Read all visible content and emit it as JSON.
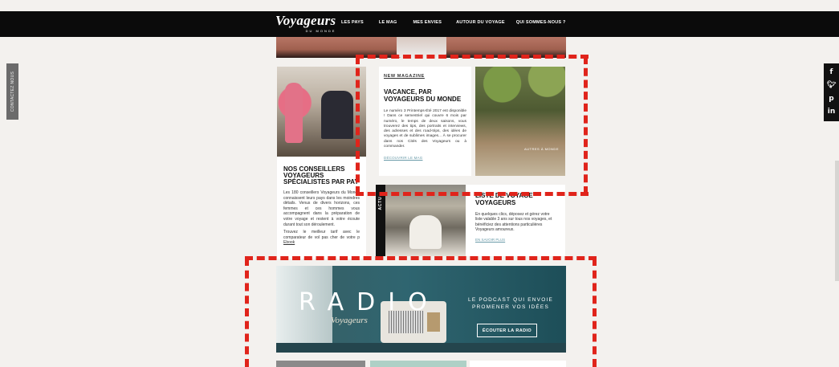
{
  "nav": {
    "logo": "Voyageurs",
    "logo_sub": "DU MONDE",
    "items": [
      "LES PAYS",
      "LE MAG",
      "MES ENVIES",
      "AUTOUR DU VOYAGE",
      "QUI SOMMES-NOUS ?"
    ]
  },
  "contact_tab": "CONTACTEZ NOUS",
  "social": [
    "f",
    "t",
    "p",
    "in"
  ],
  "conseillers": {
    "title": "NOS CONSEILLERS VOYAGEURS SPÉCIALISTES PAR PAY",
    "p1": "Les 180 conseillers Voyageurs du Monde connaissent leurs pays dans les moindres détails. Venus de divers horizons, ces femmes et ces hommes vous accompagnent dans la préparation de votre voyage et restent à votre écoute durant tout son déroulement.",
    "p2": "Trouvez le meilleur tarif avec le comparateur de vol pas cher de votre p",
    "p2_link": "Ebook"
  },
  "magazine": {
    "tag": "NEW MAGAZINE",
    "title": "VACANCE, PAR VOYAGEURS DU MONDE",
    "body": "Le numéro 3 Printemps-Été 2017 est disponible ! Dans ce semestriel qui couvre 6 mois par numéro, le temps de deux saisons, vous trouverez des tips, des portraits et interviews, des adresses et des road-trips, des idées de voyages et de sublimes images... À se procurer dans nos Cités des Voyageurs ou à commander.",
    "link": "DÉCOUVRIR LE MAG",
    "cover_caption": "AUTRES À MONDE"
  },
  "liste": {
    "actu": "ACTU",
    "title": "LISTE DE VOYAGE VOYAGEURS",
    "body": "En quelques clics, déposez et gérez votre liste valable 3 ans sur tous nos voyages, et bénéficiez des attentions particulières Voyageurs amoureux.",
    "link": "EN SAVOIR PLUS"
  },
  "radio": {
    "title": "RADIO",
    "subtitle": "Voyageurs",
    "podcast": "LE PODCAST QUI ENVOIE PROMENER VOS IDÉES",
    "button": "ÉCOUTER LA RADIO"
  },
  "colors": {
    "nav_bg": "#0b0b0b",
    "annotation": "#e0241b",
    "link": "#6a9ba9",
    "page_bg": "#f3f1ee"
  }
}
